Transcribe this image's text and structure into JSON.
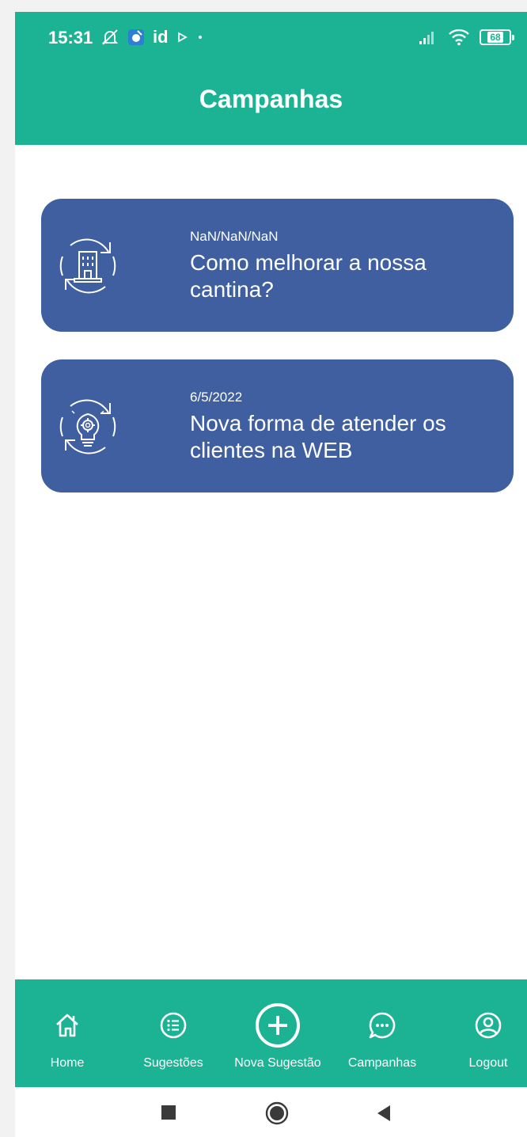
{
  "status_bar": {
    "time": "15:31",
    "icons": [
      "alarm-off-icon",
      "app-icon",
      "play-icon",
      "dot-icon",
      "signal-icon",
      "wifi-icon",
      "battery-icon"
    ],
    "id_text": "id",
    "battery_level": "68"
  },
  "header": {
    "title": "Campanhas"
  },
  "campaigns": [
    {
      "date": "NaN/NaN/NaN",
      "title": "Como melhorar a nossa cantina?",
      "icon": "building-cycle-icon"
    },
    {
      "date": "6/5/2022",
      "title": "Nova forma de atender os clientes na WEB",
      "icon": "lightbulb-gear-cycle-icon"
    }
  ],
  "bottom_nav": {
    "items": [
      {
        "label": "Home",
        "icon": "home-icon"
      },
      {
        "label": "Sugestões",
        "icon": "list-icon"
      },
      {
        "label": "Nova Sugestão",
        "icon": "plus-circle-icon"
      },
      {
        "label": "Campanhas",
        "icon": "chat-icon"
      },
      {
        "label": "Logout",
        "icon": "user-circle-icon"
      }
    ]
  },
  "system_nav": {
    "buttons": [
      "recents-square-icon",
      "home-circle-icon",
      "back-triangle-icon"
    ]
  },
  "colors": {
    "primary": "#1cb394",
    "card": "#3f5fa0",
    "text_on_primary": "#ffffff"
  }
}
